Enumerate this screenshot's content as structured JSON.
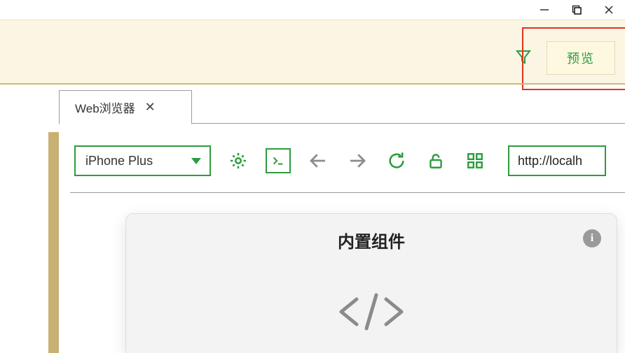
{
  "window_controls": {
    "minimize_icon": "minimize",
    "maximize_icon": "maximize",
    "close_icon": "close"
  },
  "ribbon": {
    "filter_icon": "filter",
    "preview_button_label": "预览"
  },
  "tab": {
    "label": "Web浏览器",
    "close_icon": "close"
  },
  "toolbar": {
    "device_selected": "iPhone Plus",
    "settings_icon": "gear",
    "console_icon": "terminal",
    "back_icon": "arrow-left",
    "forward_icon": "arrow-right",
    "reload_icon": "reload",
    "lock_icon": "unlock",
    "grid_icon": "grid",
    "url_value": "http://localh"
  },
  "preview": {
    "title": "内置组件",
    "info_icon": "info",
    "code_glyph": "</>"
  },
  "colors": {
    "accent_green": "#2c9c3e",
    "ribbon_bg": "#fbf6e3",
    "gold": "#c9b173",
    "highlight_red": "#e2321f"
  }
}
